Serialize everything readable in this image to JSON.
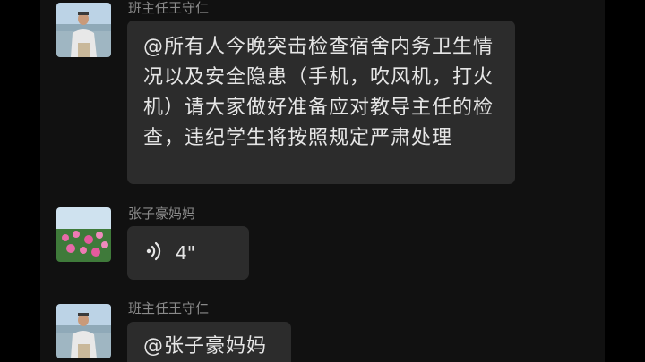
{
  "messages": [
    {
      "sender": "班主任王守仁",
      "avatar": "man-by-lake-photo",
      "type": "text",
      "text": "@所有人今晚突击检查宿舍内务卫生情况以及安全隐患（手机，吹风机，打火机）请大家做好准备应对教导主任的检查，违纪学生将按照规定严肃处理"
    },
    {
      "sender": "张子豪妈妈",
      "avatar": "pink-flowers-photo",
      "type": "voice",
      "duration": "4\"",
      "icon": "voice-wave-icon"
    },
    {
      "sender": "班主任王守仁",
      "avatar": "man-by-lake-photo",
      "type": "text",
      "text": "@张子豪妈妈"
    }
  ],
  "colors": {
    "background": "#111111",
    "bubble": "#2c2c2c",
    "text": "#e6e6e6",
    "sender": "#8a8a8a"
  }
}
